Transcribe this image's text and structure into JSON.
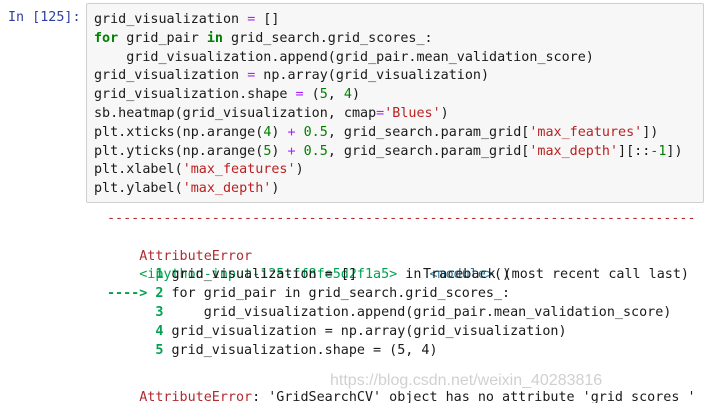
{
  "prompt": "In [125]:",
  "code_lines": [
    [
      {
        "t": "grid_visualization ",
        "c": "plain"
      },
      {
        "t": "=",
        "c": "op"
      },
      {
        "t": " []",
        "c": "plain"
      }
    ],
    [
      {
        "t": "for",
        "c": "kw"
      },
      {
        "t": " grid_pair ",
        "c": "plain"
      },
      {
        "t": "in",
        "c": "kw"
      },
      {
        "t": " grid_search.grid_scores_:",
        "c": "plain"
      }
    ],
    [
      {
        "t": "    grid_visualization.append(grid_pair.mean_validation_score)",
        "c": "plain"
      }
    ],
    [
      {
        "t": "grid_visualization ",
        "c": "plain"
      },
      {
        "t": "=",
        "c": "op"
      },
      {
        "t": " np.array(grid_visualization)",
        "c": "plain"
      }
    ],
    [
      {
        "t": "grid_visualization.shape ",
        "c": "plain"
      },
      {
        "t": "=",
        "c": "op"
      },
      {
        "t": " (",
        "c": "plain"
      },
      {
        "t": "5",
        "c": "num"
      },
      {
        "t": ", ",
        "c": "plain"
      },
      {
        "t": "4",
        "c": "num"
      },
      {
        "t": ")",
        "c": "plain"
      }
    ],
    [
      {
        "t": "sb.heatmap(grid_visualization, cmap",
        "c": "plain"
      },
      {
        "t": "=",
        "c": "op"
      },
      {
        "t": "'Blues'",
        "c": "str"
      },
      {
        "t": ")",
        "c": "plain"
      }
    ],
    [
      {
        "t": "plt.xticks(np.arange(",
        "c": "plain"
      },
      {
        "t": "4",
        "c": "num"
      },
      {
        "t": ") ",
        "c": "plain"
      },
      {
        "t": "+",
        "c": "op"
      },
      {
        "t": " ",
        "c": "plain"
      },
      {
        "t": "0.5",
        "c": "num"
      },
      {
        "t": ", grid_search.param_grid[",
        "c": "plain"
      },
      {
        "t": "'max_features'",
        "c": "str"
      },
      {
        "t": "])",
        "c": "plain"
      }
    ],
    [
      {
        "t": "plt.yticks(np.arange(",
        "c": "plain"
      },
      {
        "t": "5",
        "c": "num"
      },
      {
        "t": ") ",
        "c": "plain"
      },
      {
        "t": "+",
        "c": "op"
      },
      {
        "t": " ",
        "c": "plain"
      },
      {
        "t": "0.5",
        "c": "num"
      },
      {
        "t": ", grid_search.param_grid[",
        "c": "plain"
      },
      {
        "t": "'max_depth'",
        "c": "str"
      },
      {
        "t": "][::",
        "c": "plain"
      },
      {
        "t": "-1",
        "c": "num"
      },
      {
        "t": "])",
        "c": "plain"
      }
    ],
    [
      {
        "t": "plt.xlabel(",
        "c": "plain"
      },
      {
        "t": "'max_features'",
        "c": "str"
      },
      {
        "t": ")",
        "c": "plain"
      }
    ],
    [
      {
        "t": "plt.ylabel(",
        "c": "plain"
      },
      {
        "t": "'max_depth'",
        "c": "str"
      },
      {
        "t": ")",
        "c": "plain"
      }
    ]
  ],
  "output": {
    "separator": "---------------------------------------------------------------------------",
    "error_name": "AttributeError",
    "traceback_label": "Traceback (most recent call last)",
    "source_file": "<ipython-input-125-ff8fe5d2f1a5>",
    "source_in": " in ",
    "source_module": "<module>",
    "source_parens": "()",
    "frames": [
      [
        {
          "t": "      1 ",
          "c": "green-b"
        },
        {
          "t": "grid_visualization ",
          "c": "plain"
        },
        {
          "t": "= ",
          "c": "plain"
        },
        {
          "t": "[]",
          "c": "plain"
        }
      ],
      [
        {
          "t": "----> 2 ",
          "c": "green-b"
        },
        {
          "t": "for",
          "c": "plain"
        },
        {
          "t": " grid_pair ",
          "c": "plain"
        },
        {
          "t": "in",
          "c": "plain"
        },
        {
          "t": " grid_search.grid_scores_:",
          "c": "plain"
        }
      ],
      [
        {
          "t": "      3 ",
          "c": "green-b"
        },
        {
          "t": "    grid_visualization.append(grid_pair.mean_validation_score)",
          "c": "plain"
        }
      ],
      [
        {
          "t": "      4 ",
          "c": "green-b"
        },
        {
          "t": "grid_visualization ",
          "c": "plain"
        },
        {
          "t": "=",
          "c": "plain"
        },
        {
          "t": " np.array(grid_visualization)",
          "c": "plain"
        }
      ],
      [
        {
          "t": "      5 ",
          "c": "green-b"
        },
        {
          "t": "grid_visualization.shape ",
          "c": "plain"
        },
        {
          "t": "=",
          "c": "plain"
        },
        {
          "t": " (5, 4)",
          "c": "plain"
        }
      ]
    ],
    "final_error_name": "AttributeError",
    "final_message": ": 'GridSearchCV' object has no attribute 'grid_scores_'"
  },
  "watermark": "https://blog.csdn.net/weixin_40283816",
  "colors": {
    "prompt": "#303f9f",
    "keyword": "#008000",
    "operator": "#aa22ff",
    "string": "#ba2121",
    "error": "#b22b31",
    "line_number": "#00a250",
    "input_bg": "#f7f7f7"
  }
}
